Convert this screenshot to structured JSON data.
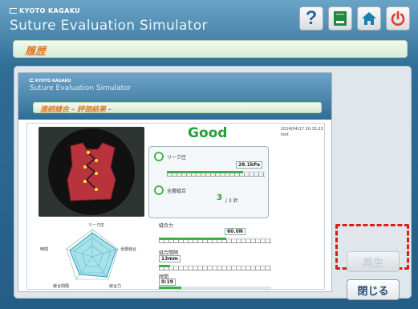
{
  "header": {
    "brand": "KYOTO KAGAKU",
    "title": "Suture Evaluation Simulator",
    "icons": [
      "help-icon",
      "report-book-icon",
      "home-icon",
      "power-icon"
    ],
    "help_glyph": "?"
  },
  "section": {
    "title": "履歴"
  },
  "report": {
    "brand": "KYOTO KAGAKU",
    "title": "Suture Evaluation Simulator",
    "subtitle": "連続縫合 - 評価結果 -",
    "result": "Good",
    "timestamp": "2014/04/17 10:15:23",
    "user": "test",
    "leak": {
      "label": "リーク圧",
      "value": "28.1kPa",
      "level": 0.78
    },
    "full_suture": {
      "label": "全層縫合",
      "count": "3",
      "total": "/ 3 針"
    },
    "tension": {
      "label": "縫合力",
      "value": "60.0N",
      "level": 0.6
    },
    "interval": {
      "label": "縫合間隔",
      "value": "13mm",
      "level": 0.1
    },
    "time": {
      "label": "時間",
      "value": "0:19",
      "level": 0.2
    },
    "radar": {
      "labels": [
        "リーク圧",
        "全層縫合",
        "縫合力",
        "縫合間隔",
        "時間"
      ]
    }
  },
  "buttons": {
    "play": "再生",
    "close": "閉じる"
  },
  "colors": {
    "accent_green": "#24a13b",
    "header_blue": "#2f6d96",
    "highlight": "#e01919"
  }
}
